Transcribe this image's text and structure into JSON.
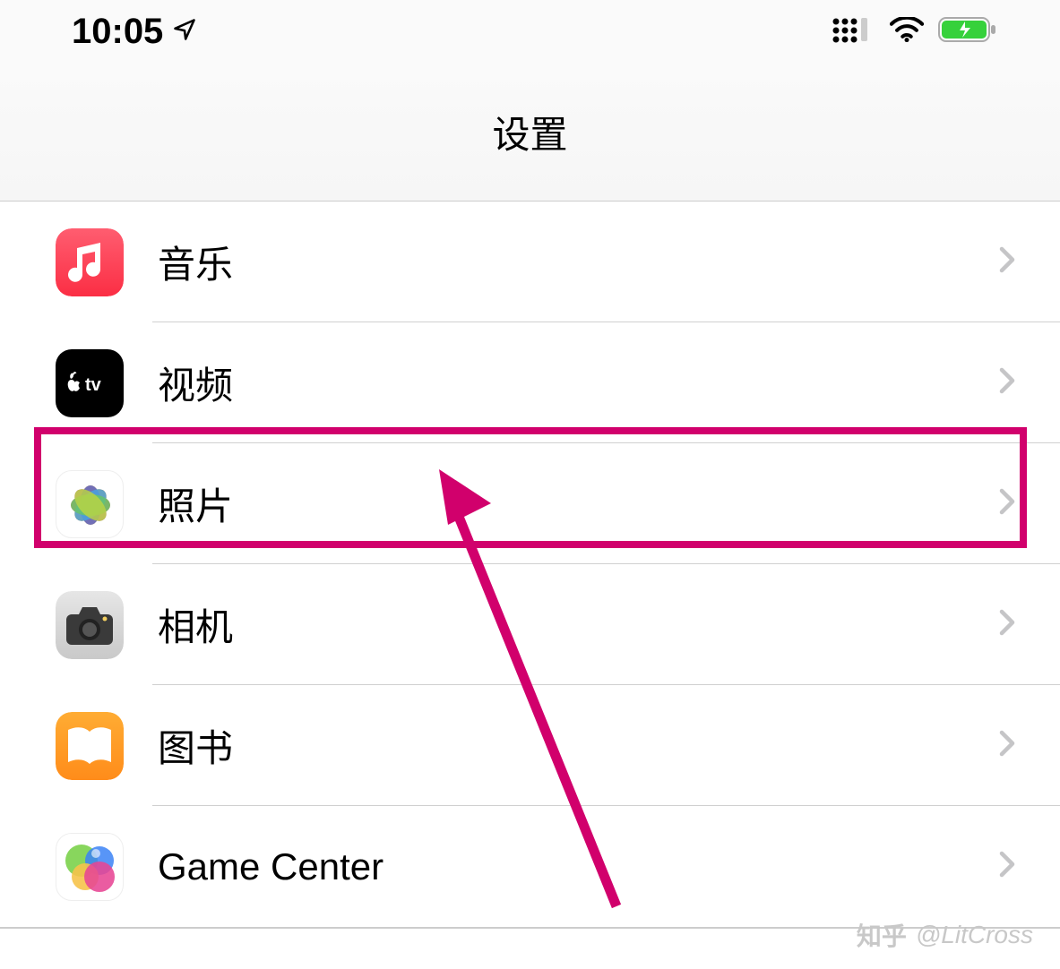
{
  "statusBar": {
    "time": "10:05"
  },
  "header": {
    "title": "设置"
  },
  "rows": [
    {
      "label": "音乐",
      "icon": "music"
    },
    {
      "label": "视频",
      "icon": "appletv"
    },
    {
      "label": "照片",
      "icon": "photos",
      "highlighted": true
    },
    {
      "label": "相机",
      "icon": "camera"
    },
    {
      "label": "图书",
      "icon": "books"
    },
    {
      "label": "Game Center",
      "icon": "gamecenter"
    }
  ],
  "annotation": {
    "color": "#d1006c"
  },
  "watermark": {
    "logo": "知乎",
    "text": "@LitCross"
  }
}
